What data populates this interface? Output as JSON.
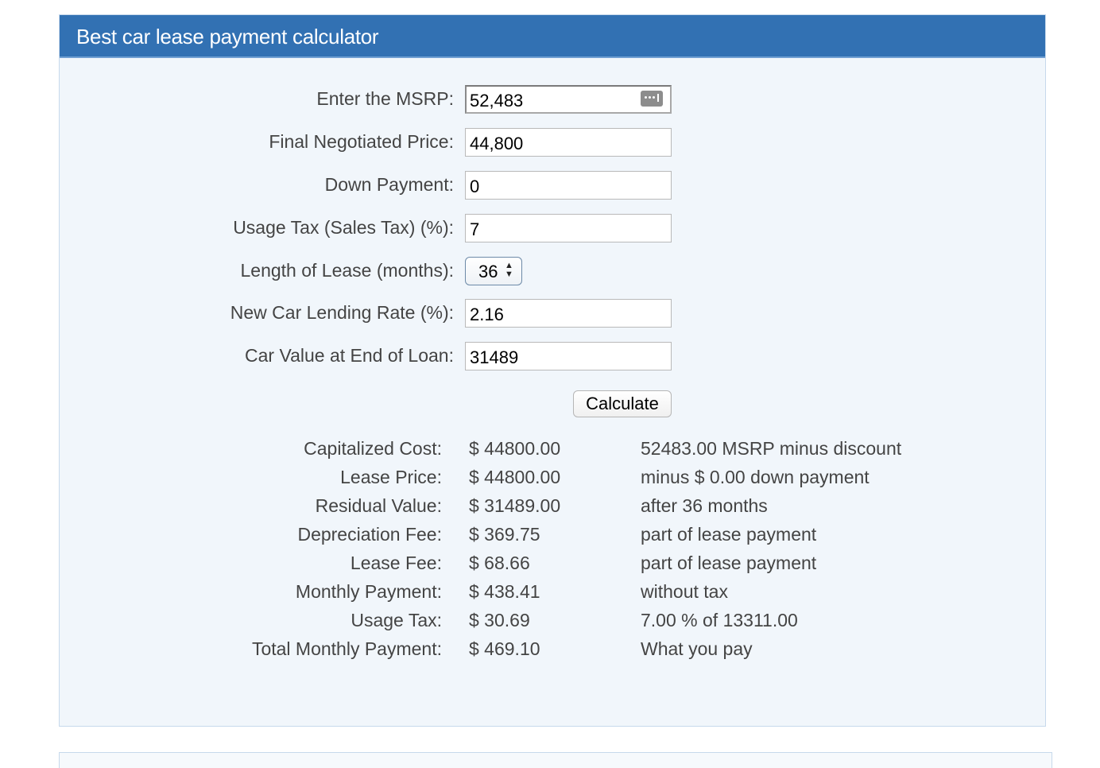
{
  "calculator": {
    "title": "Best car lease payment calculator",
    "fields": {
      "msrp": {
        "label": "Enter the MSRP:",
        "value": "52,483"
      },
      "negotiated_price": {
        "label": "Final Negotiated Price:",
        "value": "44,800"
      },
      "down_payment": {
        "label": "Down Payment:",
        "value": "0"
      },
      "usage_tax": {
        "label": "Usage Tax (Sales Tax) (%):",
        "value": "7"
      },
      "lease_length": {
        "label": "Length of Lease (months):",
        "value": "36"
      },
      "lending_rate": {
        "label": "New Car Lending Rate (%):",
        "value": "2.16"
      },
      "car_value_end": {
        "label": "Car Value at End of Loan:",
        "value": "31489"
      }
    },
    "calculate_label": "Calculate",
    "results": [
      {
        "label": "Capitalized Cost:",
        "value": "$ 44800.00",
        "note": "52483.00 MSRP minus discount"
      },
      {
        "label": "Lease Price:",
        "value": "$ 44800.00",
        "note": "minus $ 0.00 down payment"
      },
      {
        "label": "Residual Value:",
        "value": "$ 31489.00",
        "note": "after 36 months"
      },
      {
        "label": "Depreciation Fee:",
        "value": "$ 369.75",
        "note": "part of lease payment"
      },
      {
        "label": "Lease Fee:",
        "value": "$ 68.66",
        "note": "part of lease payment"
      },
      {
        "label": "Monthly Payment:",
        "value": "$ 438.41",
        "note": "without tax"
      },
      {
        "label": "Usage Tax:",
        "value": "$ 30.69",
        "note": "7.00 % of 13311.00"
      },
      {
        "label": "Total Monthly Payment:",
        "value": "$ 469.10",
        "note": "What you pay"
      }
    ]
  },
  "colors": {
    "header_bg": "#3271b3",
    "panel_bg": "#f1f6fb",
    "label_text": "#444444"
  },
  "icons": {
    "msrp_field_icon": "password-manager-dots-icon",
    "select_arrows": "up-down-arrows-icon"
  }
}
